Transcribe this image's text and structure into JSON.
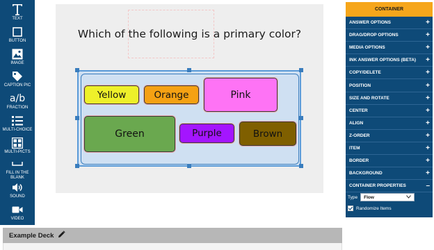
{
  "toolbar": {
    "items": [
      {
        "label": "TEXT",
        "icon": "text-icon"
      },
      {
        "label": "BUTTON",
        "icon": "button-square-icon"
      },
      {
        "label": "IMAGE",
        "icon": "image-icon"
      },
      {
        "label": "CAPTION PIC",
        "icon": "tag-icon"
      },
      {
        "label": "FRACTION",
        "glyph": "a/b",
        "icon": "fraction-icon"
      },
      {
        "label": "MULTI-CHOICE",
        "icon": "list-icon"
      },
      {
        "label": "MULTI-PICTS",
        "icon": "grid-icon"
      },
      {
        "label": "FILL IN THE BLANK",
        "icon": "blank-line-icon"
      },
      {
        "label": "SOUND",
        "icon": "speaker-icon"
      },
      {
        "label": "VIDEO",
        "icon": "video-camera-icon"
      }
    ]
  },
  "slide": {
    "question": "Which of the following is a primary color?",
    "choices": [
      {
        "label": "Yellow",
        "color": "#eef02a"
      },
      {
        "label": "Orange",
        "color": "#f5a113"
      },
      {
        "label": "Pink",
        "color": "#fe73f5"
      },
      {
        "label": "Green",
        "color": "#6aa84f"
      },
      {
        "label": "Purple",
        "color": "#a415ff"
      },
      {
        "label": "Brown",
        "color": "#7f5f00"
      }
    ]
  },
  "panel": {
    "title": "CONTAINER",
    "sections": [
      {
        "label": "ANSWER OPTIONS",
        "state": "+"
      },
      {
        "label": "DRAG/DROP OPTIONS",
        "state": "+"
      },
      {
        "label": "MEDIA OPTIONS",
        "state": "+"
      },
      {
        "label": "INK ANSWER OPTIONS (BETA)",
        "state": "+"
      },
      {
        "label": "COPY/DELETE",
        "state": "+"
      },
      {
        "label": "POSITION",
        "state": "+"
      },
      {
        "label": "SIZE AND ROTATE",
        "state": "+"
      },
      {
        "label": "CENTER",
        "state": "+"
      },
      {
        "label": "ALIGN",
        "state": "+"
      },
      {
        "label": "Z-ORDER",
        "state": "+"
      },
      {
        "label": "ITEM",
        "state": "+"
      },
      {
        "label": "BORDER",
        "state": "+"
      },
      {
        "label": "BACKGROUND",
        "state": "+"
      },
      {
        "label": "CONTAINER PROPERTIES",
        "state": "–"
      }
    ],
    "type_label": "Type",
    "type_value": "Flow",
    "randomize_label": "Randomize Items",
    "randomize_checked": true
  },
  "deck": {
    "title": "Example Deck"
  },
  "colors": {
    "panel_bg": "#0e4a78",
    "accent": "#f6a61b"
  }
}
